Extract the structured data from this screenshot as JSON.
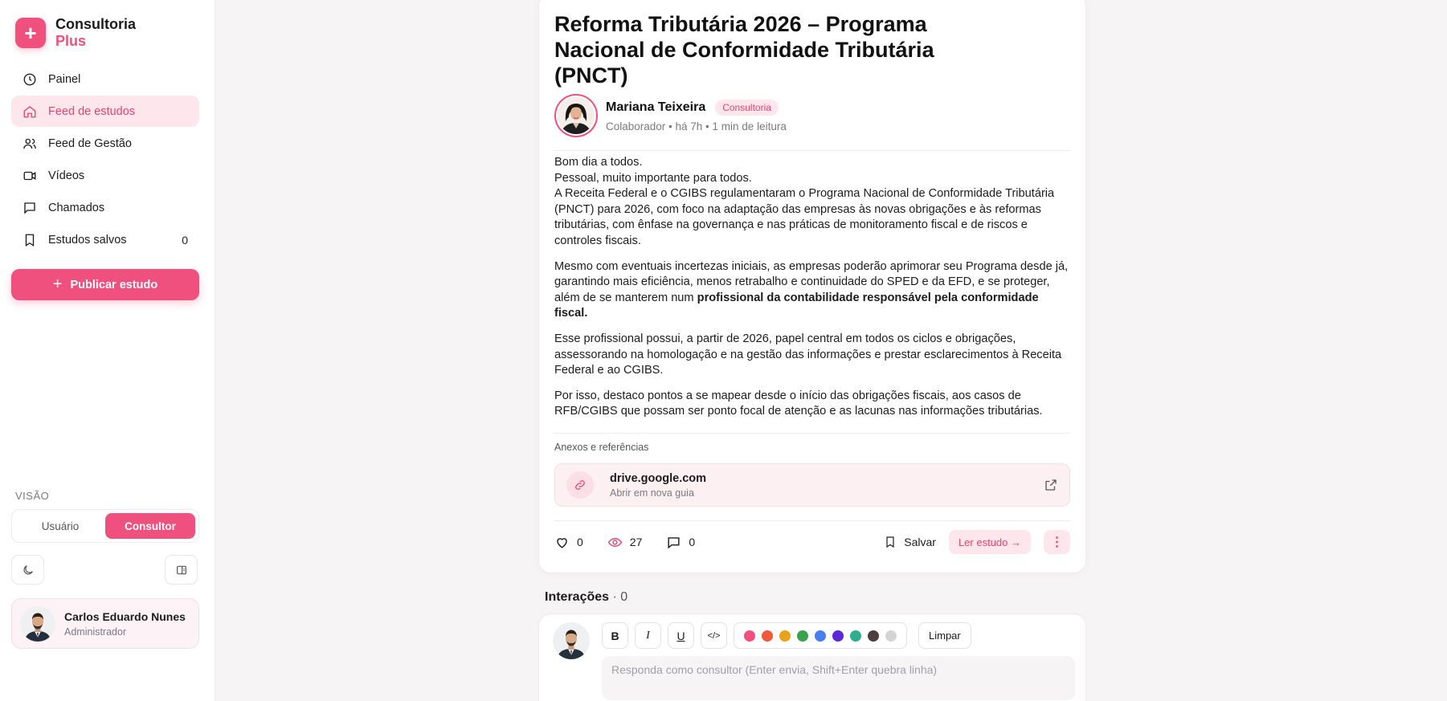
{
  "brand": {
    "name": "Consultoria",
    "sub": "Plus",
    "logo_icon": "plus-icon",
    "accent": "#f0507e"
  },
  "sidebar": {
    "items": [
      {
        "label": "Painel",
        "icon": "clock-icon"
      },
      {
        "label": "Feed de estudos",
        "icon": "home-icon",
        "active": true
      },
      {
        "label": "Feed de Gestão",
        "icon": "users-icon"
      },
      {
        "label": "Vídeos",
        "icon": "video-icon"
      },
      {
        "label": "Chamados",
        "icon": "chat-icon"
      },
      {
        "label": "Estudos salvos",
        "icon": "bookmark-icon",
        "count": "0"
      }
    ],
    "publish_label": "Publicar estudo",
    "vision_label": "VISÃO",
    "vision_options": [
      "Usuário",
      "Consultor"
    ],
    "vision_selected": "Consultor",
    "user": {
      "name": "Carlos Eduardo Nunes",
      "role": "Administrador"
    }
  },
  "post": {
    "title": "Reforma Tributária 2026 – Programa Nacional de Conformidade Tributária (PNCT)",
    "author": {
      "name": "Mariana Teixeira",
      "tag": "Consultoria",
      "meta": "Colaborador • há 7h • 1 min de leitura"
    },
    "body": {
      "p1_lines": [
        "Bom dia a todos.",
        "Pessoal, muito importante para todos.",
        "A Receita Federal e o CGIBS regulamentaram o Programa Nacional de Conformidade Tributária (PNCT) para 2026, com foco na adaptação das empresas às novas obrigações e às reformas tributárias, com ênfase na governança e nas práticas de monitoramento fiscal e de riscos e controles fiscais."
      ],
      "p2": "Mesmo com eventuais incertezas iniciais, as empresas poderão aprimorar seu Programa desde já, garantindo mais eficiência, menos retrabalho e continuidade do SPED e da EFD, e se proteger, além de se manterem num",
      "p2_bold": "profissional da contabilidade responsável pela conformidade fiscal.",
      "p3": "Esse profissional possui, a partir de 2026, papel central em todos os ciclos e obrigações, assessorando na homologação e na gestão das informações e prestar esclarecimentos à Receita Federal e ao CGIBS.",
      "p4": "Por isso, destaco pontos a se mapear desde o início das obrigações fiscais, aos casos de RFB/CGIBS que possam ser ponto focal de atenção e as lacunas nas informações tributárias."
    },
    "attachments_label": "Anexos e referências",
    "attachment": {
      "title": "drive.google.com",
      "sub": "Abrir em nova guia"
    },
    "likes": "0",
    "views": "27",
    "comments": "0",
    "save_label": "Salvar",
    "read_label": "Ler estudo →",
    "more_label": "⋮"
  },
  "interactions": {
    "label": "Interações",
    "count": "· 0"
  },
  "reply": {
    "bold": "B",
    "italic": "I",
    "underline": "U",
    "code": "</>",
    "colors": [
      "#f0507e",
      "#f05a3a",
      "#e8a21c",
      "#3aa24b",
      "#4a7df0",
      "#5b2ad6",
      "#2fae8f",
      "#4a3f3f",
      "#d4d4d6"
    ],
    "clear_label": "Limpar",
    "placeholder": "Responda como consultor (Enter envia, Shift+Enter quebra linha)"
  }
}
